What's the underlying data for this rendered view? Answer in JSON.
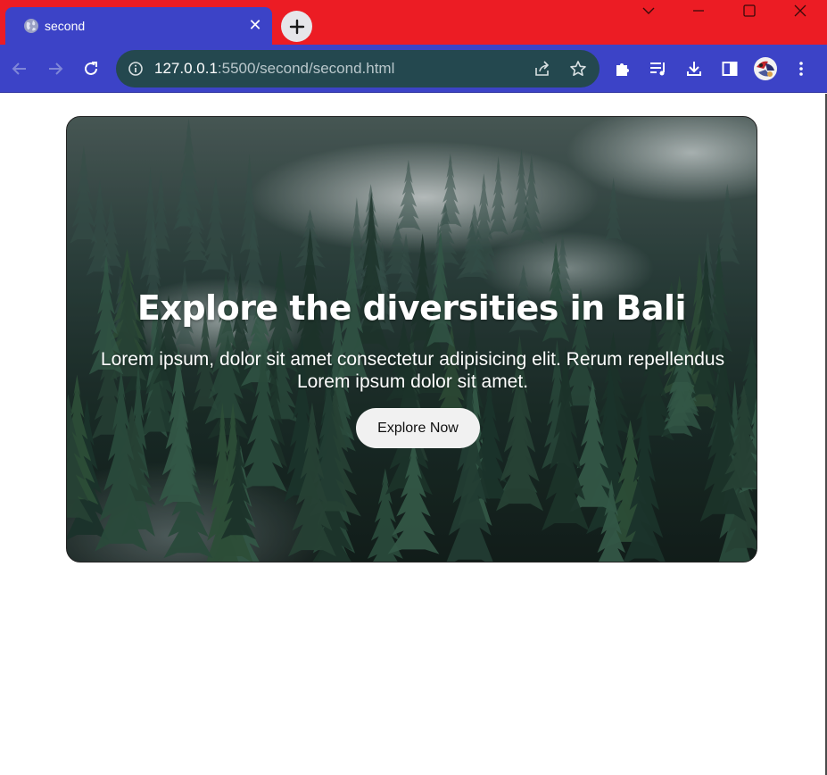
{
  "browser": {
    "tab": {
      "title": "second",
      "favicon": "globe-icon",
      "close_icon": "close-icon"
    },
    "new_tab_icon": "plus-icon",
    "window_controls": [
      "chevron-down-icon",
      "minimize-icon",
      "maximize-icon",
      "close-icon"
    ],
    "toolbar": {
      "back_icon": "back-arrow-icon",
      "forward_icon": "forward-arrow-icon",
      "reload_icon": "reload-icon",
      "url_host": "127.0.0.1",
      "url_rest": ":5500/second/second.html",
      "omnibox_icons": [
        "info-icon",
        "share-icon",
        "star-icon"
      ],
      "extension_icons": [
        "puzzle-icon",
        "media-queue-icon",
        "download-icon",
        "side-panel-icon",
        "profile-avatar",
        "more-menu-icon"
      ]
    },
    "colors": {
      "titlebar": "#ec1c24",
      "toolbar": "#3c43c7",
      "omnibox": "#24484f"
    }
  },
  "hero": {
    "title": "Explore the diversities in Bali",
    "description": "Lorem ipsum, dolor sit amet consectetur adipisicing elit. Rerum repellendus Lorem ipsum dolor sit amet.",
    "button_label": "Explore Now",
    "background_image": "misty pine forest"
  }
}
